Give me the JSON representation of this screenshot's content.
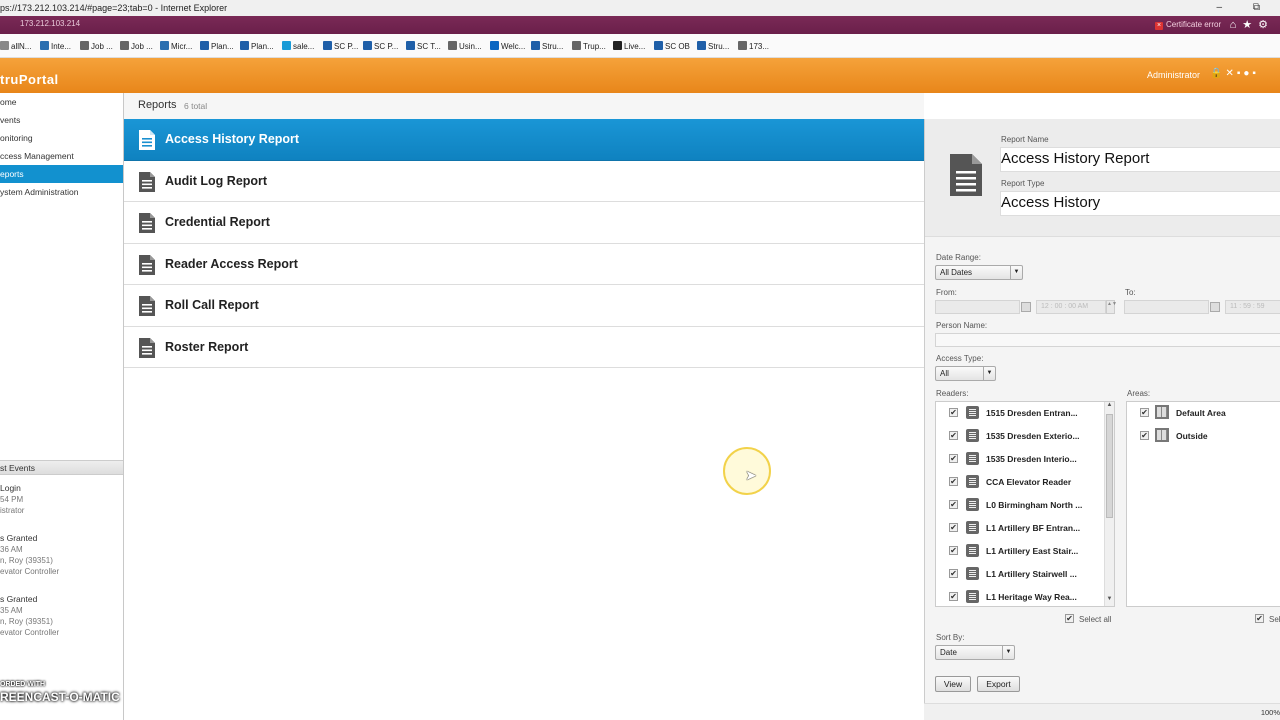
{
  "browser": {
    "title": "ps://173.212.103.214/#page=23;tab=0 - Internet Explorer",
    "url": "173.212.103.214",
    "cert_error": "Certificate error",
    "zoom": "100%",
    "favorites": [
      "allN...",
      "Inte...",
      "Job ...",
      "Job ...",
      "Micr...",
      "Plan...",
      "Plan...",
      "sale...",
      "SC P...",
      "SC P...",
      "SC T...",
      "Usin...",
      "Welc...",
      "Stru...",
      "Trup...",
      "Live...",
      "SC OB",
      "Stru...",
      "173..."
    ]
  },
  "app": {
    "logo": "truPortal",
    "user": "Administrator"
  },
  "sidebar": {
    "items": [
      "ome",
      "vents",
      "onitoring",
      "ccess Management",
      "eports",
      "ystem Administration"
    ],
    "active_index": 4,
    "latest_events_title": "st Events",
    "events": [
      {
        "title": "Login",
        "line1": "54 PM",
        "line2": "istrator",
        "line3": ""
      },
      {
        "title": "s Granted",
        "line1": "36 AM",
        "line2": "n, Roy (39351)",
        "line3": "evator Controller"
      },
      {
        "title": "s Granted",
        "line1": "35 AM",
        "line2": "n, Roy (39351)",
        "line3": "evator Controller"
      }
    ],
    "watermark_top": "ORDED WITH",
    "watermark_main": "REENCAST-O-MATIC"
  },
  "reports": {
    "title": "Reports",
    "count": "6 total",
    "items": [
      "Access History Report",
      "Audit Log Report",
      "Credential Report",
      "Reader Access Report",
      "Roll Call Report",
      "Roster Report"
    ],
    "selected_index": 0
  },
  "detail": {
    "report_name_label": "Report Name",
    "report_name": "Access History Report",
    "report_type_label": "Report Type",
    "report_type": "Access History",
    "date_range_label": "Date Range:",
    "date_range": "All Dates",
    "from_label": "From:",
    "to_label": "To:",
    "from_time": "12 : 00 : 00 AM",
    "to_time": "11 : 59 : 59",
    "person_label": "Person Name:",
    "access_type_label": "Access Type:",
    "access_type": "All",
    "readers_label": "Readers:",
    "areas_label": "Areas:",
    "readers": [
      "1515 Dresden Entran...",
      "1535 Dresden Exterio...",
      "1535 Dresden Interio...",
      "CCA Elevator Reader",
      "L0 Birmingham North ...",
      "L1 Artillery BF Entran...",
      "L1 Artillery East Stair...",
      "L1 Artillery Stairwell ...",
      "L1 Heritage Way Rea..."
    ],
    "areas": [
      "Default Area",
      "Outside"
    ],
    "select_all": "Select all",
    "select_all_areas": "Sel",
    "sort_label": "Sort By:",
    "sort_value": "Date",
    "view": "View",
    "export": "Export"
  }
}
